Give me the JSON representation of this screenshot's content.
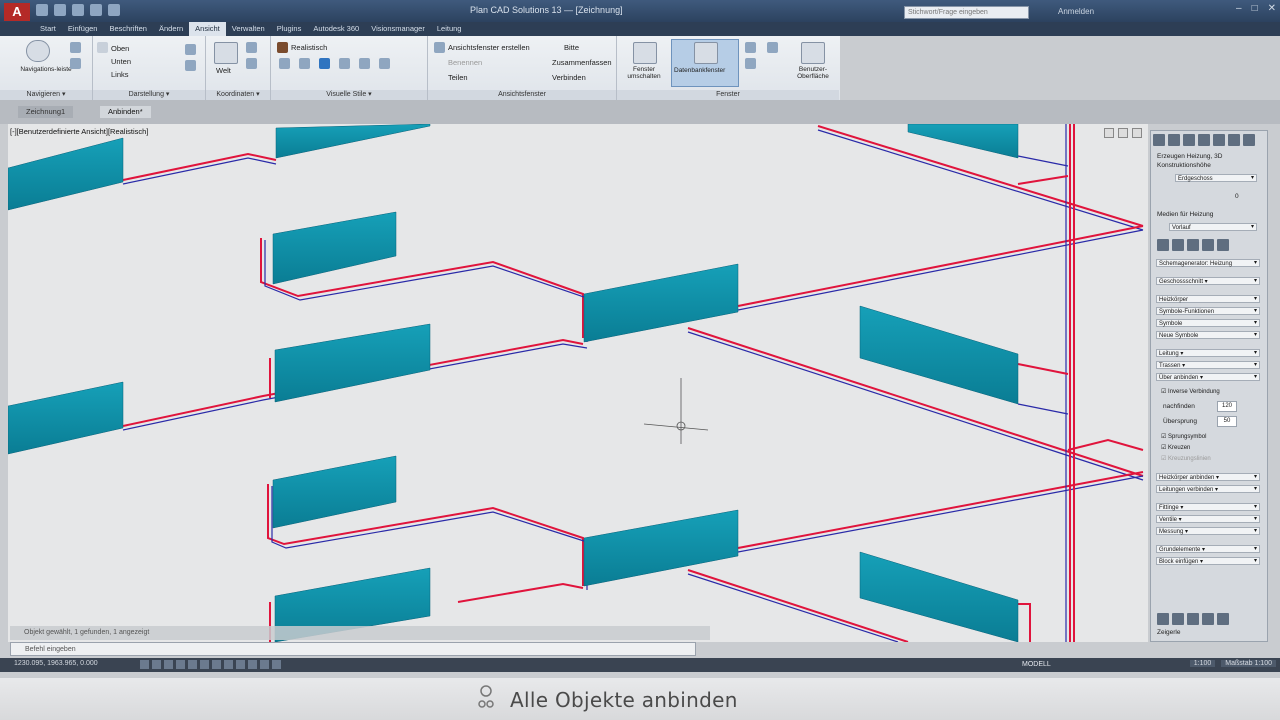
{
  "window": {
    "app_letter": "A",
    "title": "Plan CAD Solutions 13 — [Zeichnung]",
    "search_placeholder": "Stichwort/Frage eingeben",
    "user_label": "Anmelden",
    "min": "–",
    "max": "□",
    "close": "✕"
  },
  "tabs": [
    "Start",
    "Einfügen",
    "Beschriften",
    "Ändern",
    "Ansicht",
    "Verwalten",
    "Plugins",
    "Autodesk 360",
    "Visionsmanager",
    "Leitung"
  ],
  "ribbon": {
    "navigation": {
      "big_button": "Navigations-leiste",
      "label": "Navigieren ▾"
    },
    "darstellung": {
      "items": [
        "Oben",
        "Unten",
        "Links"
      ],
      "label": "Darstellung ▾"
    },
    "koordinaten": {
      "label": "Koordinaten ▾",
      "big": "Welt"
    },
    "visual": {
      "style": "Realistisch",
      "label": "Visuelle Stile ▾"
    },
    "ansichtsfenster": {
      "items": [
        "Ansichtsfenster erstellen",
        "Benennen",
        "Teilen"
      ],
      "right": [
        "Bitte",
        "Zusammenfassen",
        "Verbinden"
      ],
      "label": "Ansichtsfenster"
    },
    "fenster": {
      "btn1": "Fenster umschalten",
      "btn2": "Datenbankfenster",
      "btn3": "Benutzer-Oberfläche",
      "label": "Fenster"
    }
  },
  "filetabs": [
    "Zeichnung1",
    "Anbinden*"
  ],
  "canvas": {
    "view_label": "[-][Benutzerdefinierte Ansicht][Realistisch]"
  },
  "palette": {
    "header1": "Erzeugen Heizung, 3D",
    "header2": "Konstruktionshöhe",
    "floor": "Erdgeschoss",
    "value0": "0",
    "section_label": "Medien für Heizung",
    "medium": "Vorlauf",
    "dropdowns": [
      "Schemagenerator: Heizung",
      "Geschossschnitt ▾",
      "Heizkörper",
      "Symbole-Funktionen",
      "Symbole",
      "Neue Symbole",
      "Leitung ▾",
      "Trassen ▾",
      "Über anbinden ▾"
    ],
    "check_vert": "Inverse Verbindung",
    "nachfinden_label": "nachfinden",
    "nachfinden_val": "120",
    "uebersprung_label": "Übersprung",
    "uebersprung_val": "50",
    "checks": [
      "Sprungsymbol",
      "Kreuzen",
      "Kreuzungslinien"
    ],
    "dropdowns2": [
      "Heizkörper anbinden ▾",
      "Leitungen verbinden ▾",
      "Fittinge ▾",
      "Ventile ▾",
      "Messung ▾",
      "Grundelemente ▾",
      "Block einfügen ▾"
    ],
    "bottom_label": "Zeigerle"
  },
  "command": {
    "history": "Objekt gewählt, 1 gefunden, 1 angezeigt",
    "prompt": "Befehl eingeben"
  },
  "status": {
    "coords": "1230.095, 1963.965, 0.000",
    "scale": "1:100",
    "modell": "MODELL",
    "anno": "Maßstab 1:100"
  },
  "subtitle": {
    "text": "Alle Objekte anbinden"
  },
  "colors": {
    "radiator": "#0f8fa8",
    "supply": "#e0143c",
    "return": "#2a2aa8",
    "canvas": "#e6e7e8"
  }
}
